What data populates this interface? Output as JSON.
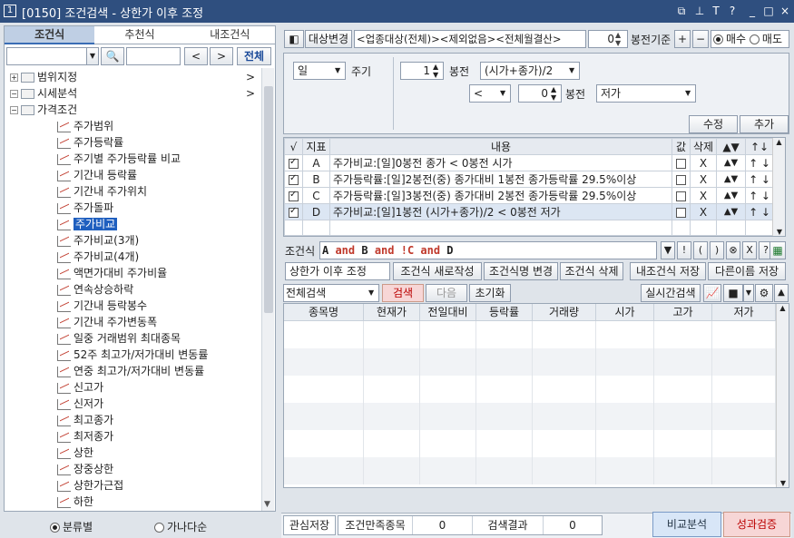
{
  "window": {
    "num": "1",
    "title": "[0150] 조건검색 - 상한가 이후 조정",
    "icons": [
      "layout-icon",
      "pin-icon",
      "font-icon",
      "help-icon",
      "minimize-icon",
      "maximize-icon",
      "close-icon"
    ],
    "icon_glyphs": [
      "⧉",
      "⊥",
      "T",
      "?",
      "_",
      "□",
      "×"
    ]
  },
  "left": {
    "tabs": [
      "조건식",
      "추천식",
      "내조건식"
    ],
    "search_btn_prev": "<",
    "search_btn_next": ">",
    "search_all": "전체",
    "tree": [
      {
        "label": "범위지정",
        "level": 0,
        "type": "folder",
        "expand": "+",
        "arrow": ">"
      },
      {
        "label": "시세분석",
        "level": 0,
        "type": "folder",
        "expand": "−",
        "arrow": ">"
      },
      {
        "label": "가격조건",
        "level": 1,
        "type": "folder",
        "expand": "−"
      },
      {
        "label": "주가범위",
        "level": 2,
        "type": "leaf"
      },
      {
        "label": "주가등락률",
        "level": 2,
        "type": "leaf"
      },
      {
        "label": "주기별 주가등락률 비교",
        "level": 2,
        "type": "leaf"
      },
      {
        "label": "기간내 등락률",
        "level": 2,
        "type": "leaf"
      },
      {
        "label": "기간내 주가위치",
        "level": 2,
        "type": "leaf"
      },
      {
        "label": "주가돌파",
        "level": 2,
        "type": "leaf"
      },
      {
        "label": "주가비교",
        "level": 2,
        "type": "leaf",
        "selected": true
      },
      {
        "label": "주가비교(3개)",
        "level": 2,
        "type": "leaf"
      },
      {
        "label": "주가비교(4개)",
        "level": 2,
        "type": "leaf"
      },
      {
        "label": "액면가대비 주가비율",
        "level": 2,
        "type": "leaf"
      },
      {
        "label": "연속상승하락",
        "level": 2,
        "type": "leaf"
      },
      {
        "label": "기간내 등락봉수",
        "level": 2,
        "type": "leaf"
      },
      {
        "label": "기간내 주가변동폭",
        "level": 2,
        "type": "leaf"
      },
      {
        "label": "일중 거래범위 최대종목",
        "level": 2,
        "type": "leaf"
      },
      {
        "label": "52주 최고가/저가대비 변동률",
        "level": 2,
        "type": "leaf"
      },
      {
        "label": "연중 최고가/저가대비 변동률",
        "level": 2,
        "type": "leaf"
      },
      {
        "label": "신고가",
        "level": 2,
        "type": "leaf"
      },
      {
        "label": "신저가",
        "level": 2,
        "type": "leaf"
      },
      {
        "label": "최고종가",
        "level": 2,
        "type": "leaf"
      },
      {
        "label": "최저종가",
        "level": 2,
        "type": "leaf"
      },
      {
        "label": "상한",
        "level": 2,
        "type": "leaf"
      },
      {
        "label": "장중상한",
        "level": 2,
        "type": "leaf"
      },
      {
        "label": "상한가근접",
        "level": 2,
        "type": "leaf"
      },
      {
        "label": "하한",
        "level": 2,
        "type": "leaf"
      }
    ],
    "sort_options": [
      "분류별",
      "가나다순"
    ],
    "sort_selected": 0
  },
  "top": {
    "target_btn": "대상변경",
    "target_text": "<업종대상(전체)><제외없음><전체월결산>",
    "bong_value": "0",
    "bong_label": "봉전기준",
    "plus": "+",
    "minus": "−",
    "trade": [
      "매수",
      "매도"
    ],
    "trade_selected": 0,
    "period_value": "일",
    "period_label": "주기",
    "row1_n": "1",
    "row1_label": "봉전",
    "row1_expr": "(시가+종가)/2",
    "row2_op": "<",
    "row2_n": "0",
    "row2_label": "봉전",
    "row2_expr": "저가",
    "edit_btn": "수정",
    "add_btn": "추가"
  },
  "cond_table": {
    "headers": [
      "√",
      "지표",
      "내용",
      "값",
      "삭제",
      "▲▼",
      "↑↓"
    ],
    "rows": [
      {
        "checked": true,
        "id": "A",
        "content": "주가비교:[일]0봉전 종가 < 0봉전 시가",
        "del": "X"
      },
      {
        "checked": true,
        "id": "B",
        "content": "주가등락률:[일]2봉전(중) 종가대비 1봉전 종가등락률 29.5%이상",
        "del": "X"
      },
      {
        "checked": true,
        "id": "C",
        "content": "주가등락률:[일]3봉전(중) 종가대비 2봉전 종가등락률 29.5%이상",
        "del": "X"
      },
      {
        "checked": true,
        "id": "D",
        "content": "주가비교:[일]1봉전 (시가+종가)/2 < 0봉전 저가",
        "del": "X"
      }
    ]
  },
  "formula": {
    "label": "조건식",
    "tokens": [
      {
        "t": "A",
        "op": false
      },
      {
        "t": " and ",
        "op": true
      },
      {
        "t": "B",
        "op": false
      },
      {
        "t": " and ",
        "op": true
      },
      {
        "t": "!C",
        "op": true
      },
      {
        "t": " and ",
        "op": true
      },
      {
        "t": "D",
        "op": false
      }
    ],
    "btns": [
      "▼",
      "!",
      "(",
      ")",
      "⊗",
      "X",
      "?"
    ]
  },
  "save": {
    "name": "상한가 이후 조정",
    "btns": [
      "조건식 새로작성",
      "조건식명 변경",
      "조건식 삭제",
      "내조건식 저장",
      "다른이름 저장"
    ]
  },
  "search": {
    "scope": "전체검색",
    "search": "검색",
    "next": "다음",
    "reset": "초기화",
    "realtime": "실시간검색"
  },
  "results": {
    "headers": [
      "종목명",
      "현재가",
      "전일대비",
      "등락률",
      "거래량",
      "시가",
      "고가",
      "저가"
    ]
  },
  "bottom": {
    "interest": "관심저장",
    "match_label": "조건만족종목",
    "match_value": "0",
    "result_label": "검색결과",
    "result_value": "0",
    "compare": "비교분석",
    "verify": "성과검증"
  },
  "colors": {
    "title_bg": "#2f4f7f",
    "selected": "#1f5fbf",
    "operator": "#c0392b"
  }
}
